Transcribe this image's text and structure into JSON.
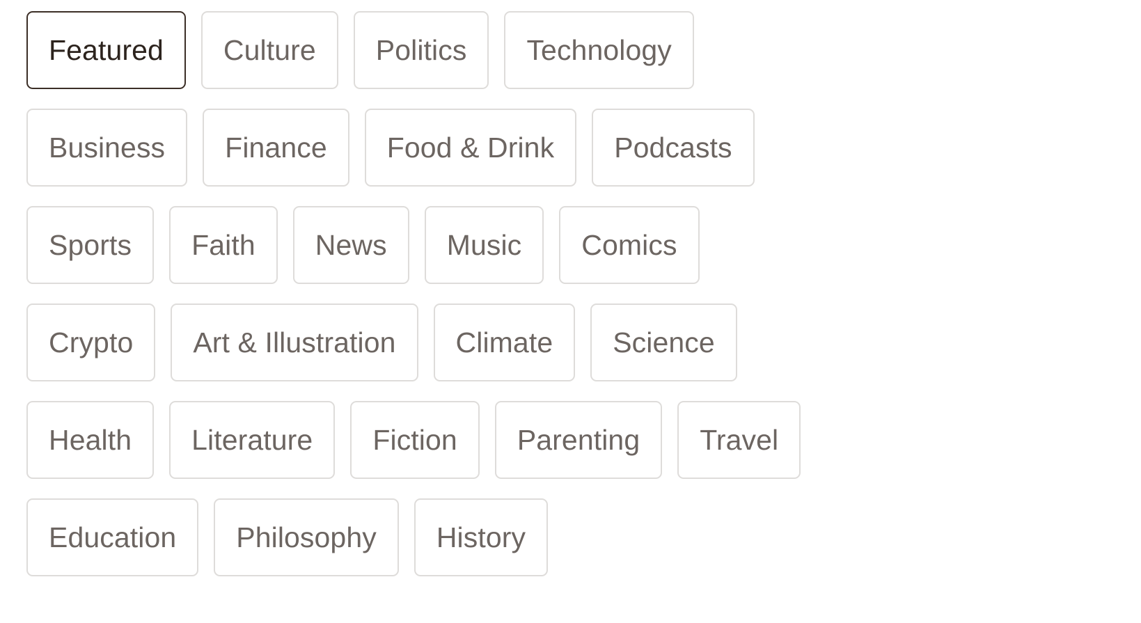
{
  "theme": {
    "background": "#ffffff",
    "chip_background": "#ffffff",
    "chip_border_inactive": "#dedcda",
    "chip_text_inactive": "#6c6561",
    "chip_border_active": "#3b2e26",
    "chip_text_active": "#2c231d"
  },
  "category_nav": {
    "active_category": "Featured",
    "rows": [
      {
        "chips": [
          {
            "label": "Featured",
            "active": true
          },
          {
            "label": "Culture",
            "active": false
          },
          {
            "label": "Politics",
            "active": false
          },
          {
            "label": "Technology",
            "active": false
          }
        ]
      },
      {
        "chips": [
          {
            "label": "Business",
            "active": false
          },
          {
            "label": "Finance",
            "active": false
          },
          {
            "label": "Food & Drink",
            "active": false
          },
          {
            "label": "Podcasts",
            "active": false
          }
        ]
      },
      {
        "chips": [
          {
            "label": "Sports",
            "active": false
          },
          {
            "label": "Faith",
            "active": false
          },
          {
            "label": "News",
            "active": false
          },
          {
            "label": "Music",
            "active": false
          },
          {
            "label": "Comics",
            "active": false
          }
        ]
      },
      {
        "chips": [
          {
            "label": "Crypto",
            "active": false
          },
          {
            "label": "Art & Illustration",
            "active": false
          },
          {
            "label": "Climate",
            "active": false
          },
          {
            "label": "Science",
            "active": false
          }
        ]
      },
      {
        "chips": [
          {
            "label": "Health",
            "active": false
          },
          {
            "label": "Literature",
            "active": false
          },
          {
            "label": "Fiction",
            "active": false
          },
          {
            "label": "Parenting",
            "active": false
          },
          {
            "label": "Travel",
            "active": false
          }
        ]
      },
      {
        "chips": [
          {
            "label": "Education",
            "active": false
          },
          {
            "label": "Philosophy",
            "active": false
          },
          {
            "label": "History",
            "active": false
          }
        ]
      }
    ]
  }
}
